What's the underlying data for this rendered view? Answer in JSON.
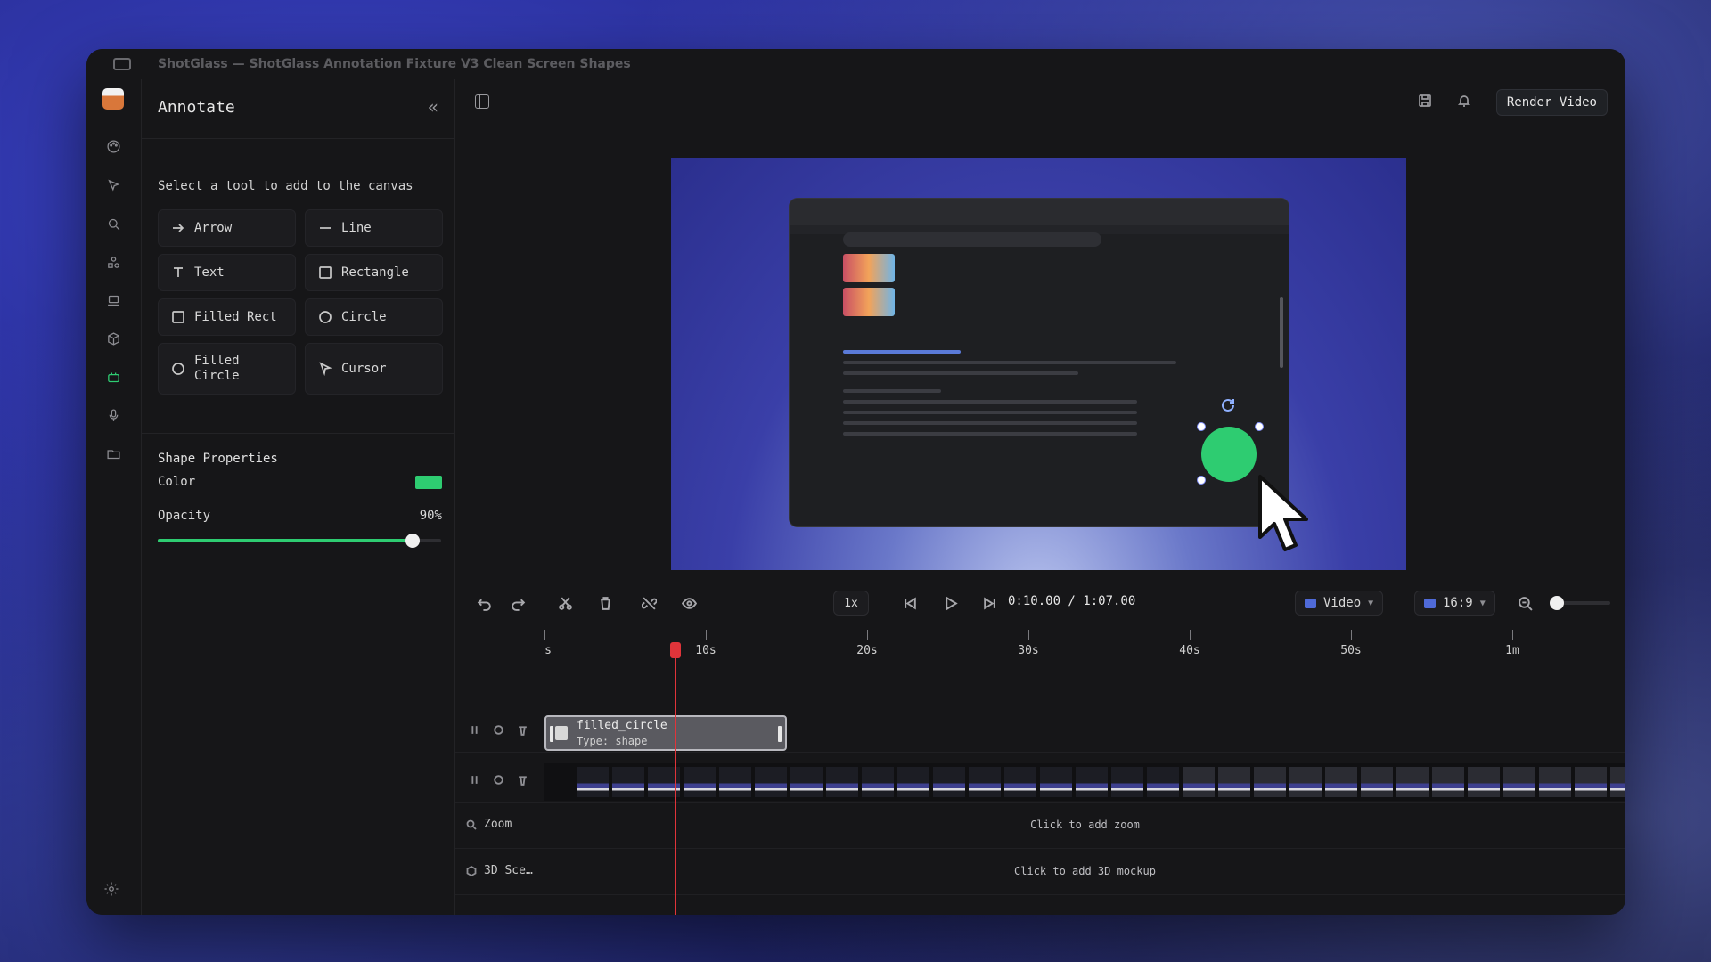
{
  "window": {
    "title": "ShotGlass — ShotGlass Annotation Fixture V3 Clean Screen Shapes"
  },
  "panel": {
    "title": "Annotate",
    "hint": "Select a tool to add to the canvas",
    "tools": {
      "arrow": "Arrow",
      "line": "Line",
      "text": "Text",
      "rectangle": "Rectangle",
      "filled_rect": "Filled Rect",
      "circle": "Circle",
      "filled_circle_1": "Filled",
      "filled_circle_2": "Circle",
      "cursor": "Cursor"
    },
    "shape_properties": {
      "title": "Shape Properties",
      "color_label": "Color",
      "color": "#2ecc71",
      "opacity_label": "Opacity",
      "opacity_value": "90%",
      "opacity_fraction": 0.9
    }
  },
  "header": {
    "render_label": "Render Video"
  },
  "transport": {
    "speed": "1x",
    "timecode": "0:10.00 / 1:07.00",
    "source_label": "Video",
    "aspect_label": "16:9"
  },
  "timeline": {
    "ticks": [
      {
        "label": "s",
        "seconds": 0
      },
      {
        "label": "10s",
        "seconds": 10
      },
      {
        "label": "20s",
        "seconds": 20
      },
      {
        "label": "30s",
        "seconds": 30
      },
      {
        "label": "40s",
        "seconds": 40
      },
      {
        "label": "50s",
        "seconds": 50
      },
      {
        "label": "1m",
        "seconds": 60
      }
    ],
    "playhead_seconds": 10,
    "clip": {
      "title": "filled_circle",
      "subtitle": "Type: shape"
    },
    "zoom_row": {
      "label": "Zoom",
      "cta": "Click to add zoom"
    },
    "scene_row": {
      "label": "3D Sce…",
      "cta": "Click to add 3D mockup"
    }
  },
  "canvas": {
    "shape_color": "#2ecc71"
  }
}
